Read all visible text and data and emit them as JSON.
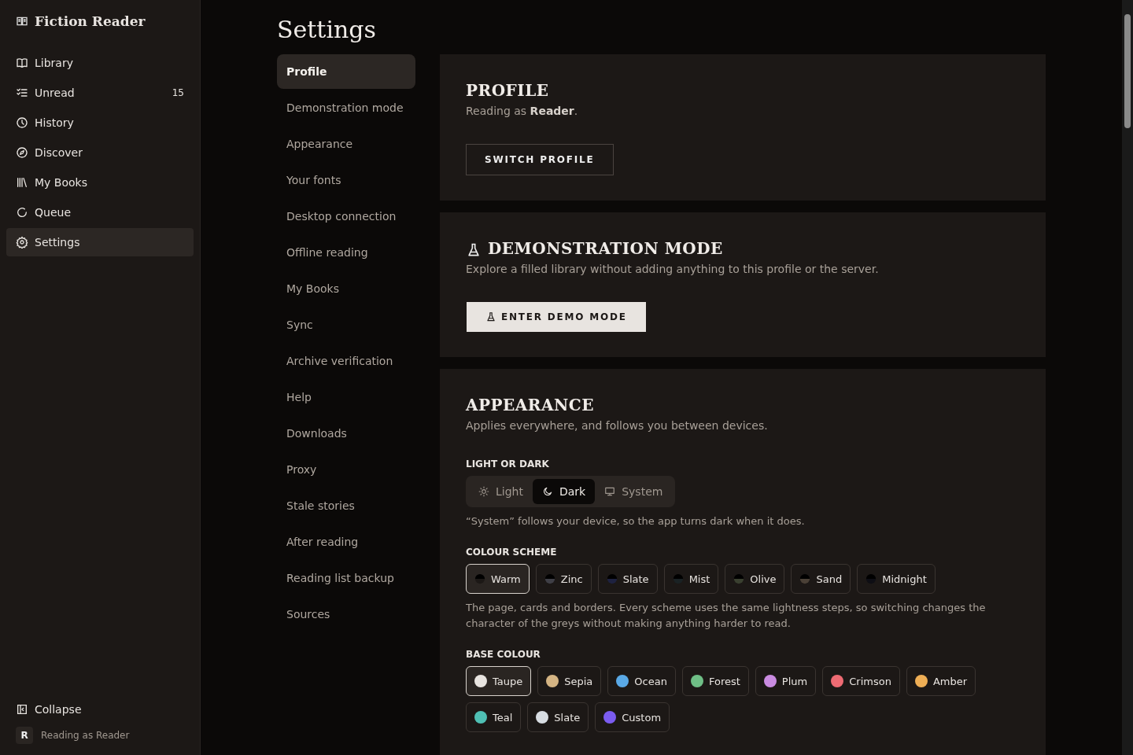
{
  "app": {
    "title": "Fiction Reader"
  },
  "sidebar": {
    "items": [
      {
        "label": "Library",
        "selected": false
      },
      {
        "label": "Unread",
        "selected": false,
        "count": "15"
      },
      {
        "label": "History",
        "selected": false
      },
      {
        "label": "Discover",
        "selected": false
      },
      {
        "label": "My Books",
        "selected": false
      },
      {
        "label": "Queue",
        "selected": false
      },
      {
        "label": "Settings",
        "selected": true
      }
    ],
    "collapse": "Collapse",
    "avatar": "R",
    "user": "Reading as Reader"
  },
  "page": {
    "title": "Settings"
  },
  "settings_nav": [
    {
      "label": "Profile",
      "selected": true
    },
    {
      "label": "Demonstration mode",
      "selected": false
    },
    {
      "label": "Appearance",
      "selected": false
    },
    {
      "label": "Your fonts",
      "selected": false
    },
    {
      "label": "Desktop connection",
      "selected": false
    },
    {
      "label": "Offline reading",
      "selected": false
    },
    {
      "label": "My Books",
      "selected": false
    },
    {
      "label": "Sync",
      "selected": false
    },
    {
      "label": "Archive verification",
      "selected": false
    },
    {
      "label": "Help",
      "selected": false
    },
    {
      "label": "Downloads",
      "selected": false
    },
    {
      "label": "Proxy",
      "selected": false
    },
    {
      "label": "Stale stories",
      "selected": false
    },
    {
      "label": "After reading",
      "selected": false
    },
    {
      "label": "Reading list backup",
      "selected": false
    },
    {
      "label": "Sources",
      "selected": false
    }
  ],
  "profile": {
    "heading": "PROFILE",
    "text": "Reading as **Reader**.",
    "button": "SWITCH PROFILE"
  },
  "demo": {
    "heading": "DEMONSTRATION MODE",
    "text": "Explore a filled library without adding anything to this profile or the server.",
    "button": "ENTER DEMO MODE"
  },
  "appearance": {
    "heading": "APPEARANCE",
    "text": "Applies everywhere, and follows you between devices.",
    "mode_label": "LIGHT OR DARK",
    "modes": [
      {
        "label": "Light",
        "selected": false
      },
      {
        "label": "Dark",
        "selected": true
      },
      {
        "label": "System",
        "selected": false
      }
    ],
    "mode_note": "“System” follows your device, so the app turns dark when it does.",
    "scheme_label": "COLOUR SCHEME",
    "schemes": [
      {
        "label": "Warm",
        "selected": true,
        "color": "#1c1816"
      },
      {
        "label": "Zinc",
        "selected": false,
        "color": "#3f3f46"
      },
      {
        "label": "Slate",
        "selected": false,
        "color": "#1e2240"
      },
      {
        "label": "Mist",
        "selected": false,
        "color": "#1a2224"
      },
      {
        "label": "Olive",
        "selected": false,
        "color": "#3a4030"
      },
      {
        "label": "Sand",
        "selected": false,
        "color": "#4a4036"
      },
      {
        "label": "Midnight",
        "selected": false,
        "color": "#0e0e14"
      }
    ],
    "scheme_note": "The page, cards and borders. Every scheme uses the same lightness steps, so switching changes the character of the greys without making anything harder to read.",
    "base_label": "BASE COLOUR",
    "bases": [
      {
        "label": "Taupe",
        "selected": true,
        "color": "#e8e4e0"
      },
      {
        "label": "Sepia",
        "selected": false,
        "color": "#d4b483"
      },
      {
        "label": "Ocean",
        "selected": false,
        "color": "#5aa9e6"
      },
      {
        "label": "Forest",
        "selected": false,
        "color": "#6fbf86"
      },
      {
        "label": "Plum",
        "selected": false,
        "color": "#c98be0"
      },
      {
        "label": "Crimson",
        "selected": false,
        "color": "#ee6b73"
      },
      {
        "label": "Amber",
        "selected": false,
        "color": "#eeae55"
      },
      {
        "label": "Teal",
        "selected": false,
        "color": "#4fc0b4"
      },
      {
        "label": "Slate",
        "selected": false,
        "color": "#d8dde2"
      },
      {
        "label": "Custom",
        "selected": false,
        "color": "#7b5cf0"
      }
    ]
  }
}
